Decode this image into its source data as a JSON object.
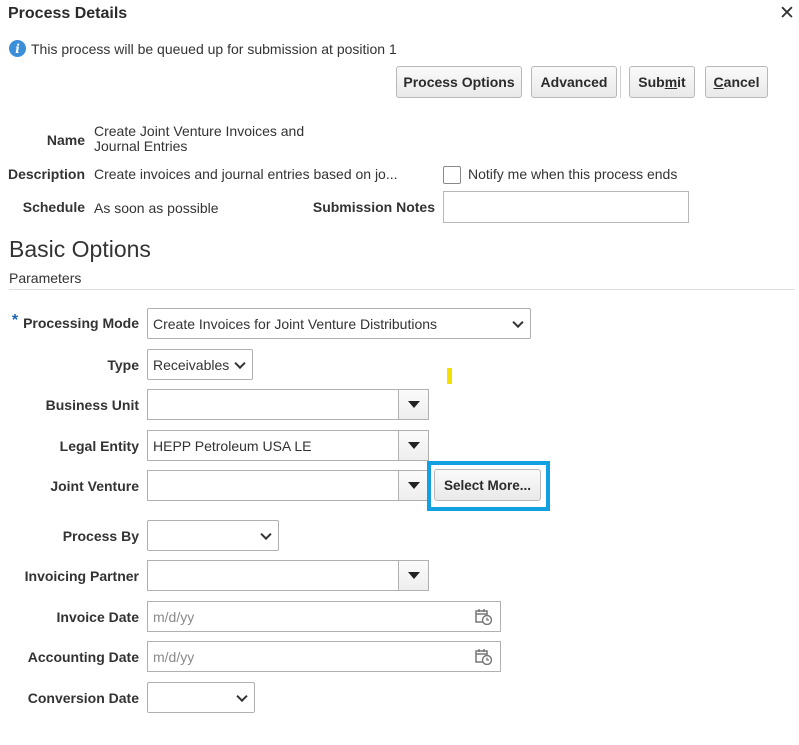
{
  "dialog": {
    "title": "Process Details",
    "close_icon": "close-icon"
  },
  "info": {
    "icon": "info-icon",
    "message": "This process will be queued up for submission at position 1"
  },
  "toolbar": {
    "process_options_label": "Process Options",
    "advanced_label": "Advanced",
    "submit_pre": "Sub",
    "submit_mn": "m",
    "submit_post": "it",
    "cancel_pre": "",
    "cancel_mn": "C",
    "cancel_post": "ancel"
  },
  "details": {
    "name_label": "Name",
    "name_value_line1": "Create Joint Venture Invoices and",
    "name_value_line2": "Journal Entries",
    "description_label": "Description",
    "description_value": "Create invoices and journal entries based on jo...",
    "schedule_label": "Schedule",
    "schedule_value": "As soon as possible",
    "notify_label": "Notify me when this process ends",
    "notify_checked": false,
    "submission_notes_label": "Submission Notes",
    "submission_notes_value": ""
  },
  "section": {
    "title": "Basic Options",
    "subtitle": "Parameters"
  },
  "params": {
    "required_mark": "*",
    "processing_mode_label": "Processing Mode",
    "processing_mode_value": "Create Invoices for Joint Venture Distributions",
    "type_label": "Type",
    "type_value": "Receivables",
    "business_unit_label": "Business Unit",
    "business_unit_value": "",
    "legal_entity_label": "Legal Entity",
    "legal_entity_value": "HEPP Petroleum USA LE",
    "joint_venture_label": "Joint Venture",
    "joint_venture_value": "",
    "select_more_label": "Select More...",
    "process_by_label": "Process By",
    "process_by_value": "",
    "invoicing_partner_label": "Invoicing Partner",
    "invoicing_partner_value": "",
    "invoice_date_label": "Invoice Date",
    "invoice_date_placeholder": "m/d/yy",
    "accounting_date_label": "Accounting Date",
    "accounting_date_placeholder": "m/d/yy",
    "conversion_date_label": "Conversion Date",
    "conversion_date_value": ""
  },
  "colors": {
    "highlight": "#12a0e0",
    "info_blue": "#3a8fd8",
    "required_blue": "#1a63b0"
  }
}
